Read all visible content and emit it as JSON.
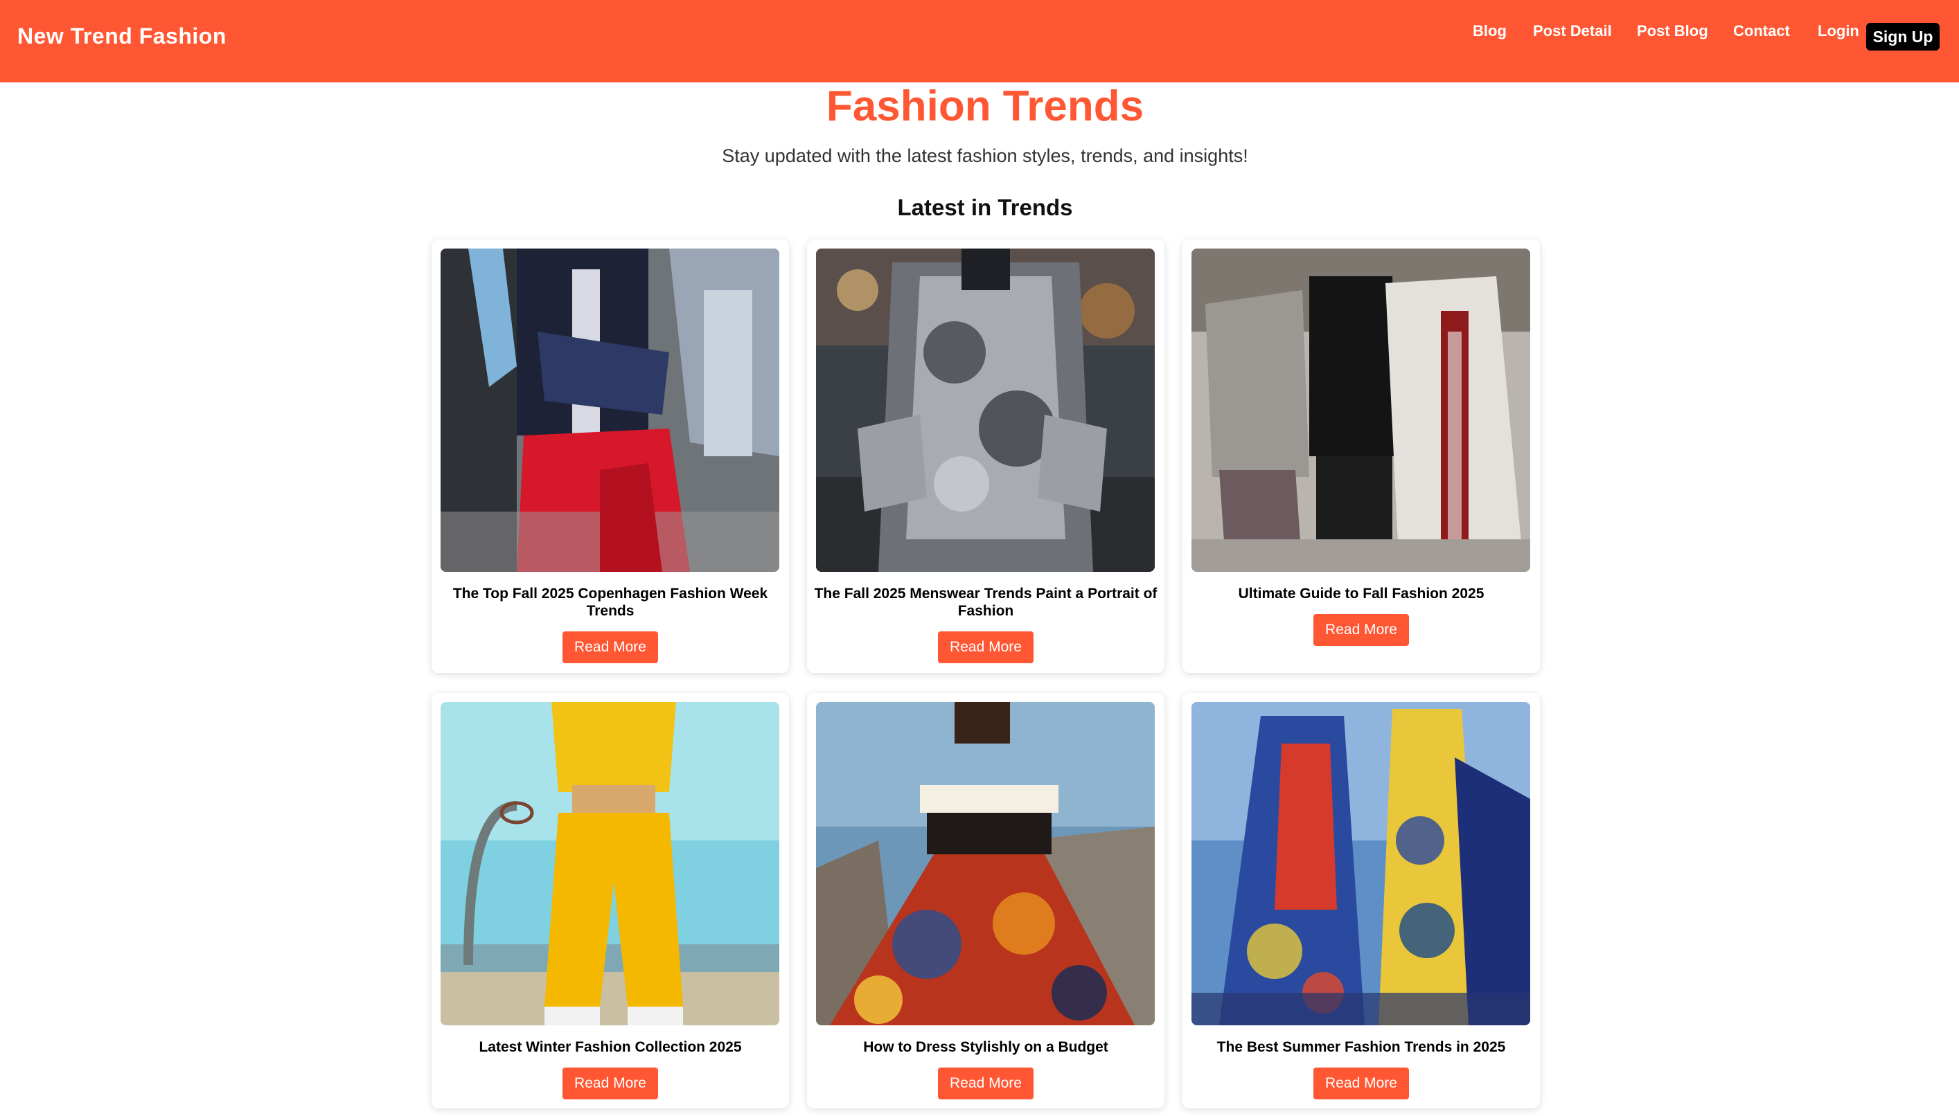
{
  "header": {
    "brand": "New Trend Fashion",
    "nav": [
      "Blog",
      "Post Detail",
      "Post Blog",
      "Contact",
      "Login"
    ],
    "signup": "Sign Up",
    "accent": "#ff5733"
  },
  "hero": {
    "title": "Fashion Trends",
    "subtitle": "Stay updated with the latest fashion styles, trends, and insights!"
  },
  "section": {
    "title": "Latest in Trends"
  },
  "cards": [
    {
      "title": "The Top Fall 2025 Copenhagen Fashion Week Trends",
      "button": "Read More"
    },
    {
      "title": "The Fall 2025 Menswear Trends Paint a Portrait of Fashion",
      "button": "Read More"
    },
    {
      "title": "Ultimate Guide to Fall Fashion 2025",
      "button": "Read More"
    },
    {
      "title": "Latest Winter Fashion Collection 2025",
      "button": "Read More"
    },
    {
      "title": "How to Dress Stylishly on a Budget",
      "button": "Read More"
    },
    {
      "title": "The Best Summer Fashion Trends in 2025",
      "button": "Read More"
    }
  ]
}
